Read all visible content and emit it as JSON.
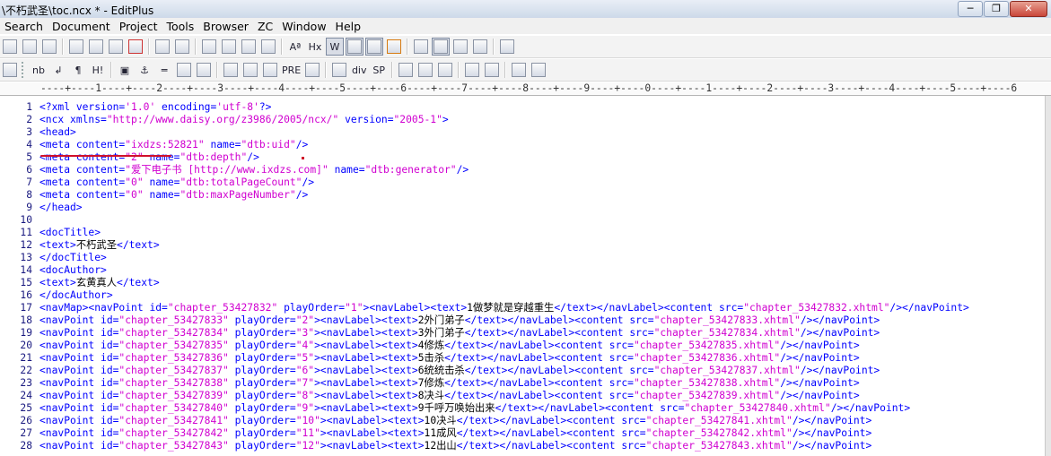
{
  "window": {
    "title": "\\不朽武圣\\toc.ncx * - EditPlus",
    "min": "─",
    "max": "❐",
    "close": "✕"
  },
  "menu": [
    "Search",
    "Document",
    "Project",
    "Tools",
    "Browser",
    "ZC",
    "Window",
    "Help"
  ],
  "toolbar2_labels": {
    "nb": "nb",
    "br": "↲",
    "para": "¶",
    "heading": "H!",
    "image": "▣",
    "anchor": "⚓",
    "hr": "═",
    "pre": "PRE",
    "div": "div",
    "sp": "SP",
    "hx": "Hx",
    "aa": "Aª",
    "bold_w": "W"
  },
  "ruler": "----+----1----+----2----+----3----+----4----+----5----+----6----+----7----+----8----+----9----+----0----+----1----+----2----+----3----+----4----+----5----+----6",
  "lines": [
    {
      "n": "1",
      "parts": [
        [
          "t",
          "<?xml "
        ],
        [
          "a",
          "version="
        ],
        [
          "s",
          "'1.0'"
        ],
        [
          "a",
          " encoding="
        ],
        [
          "s",
          "'utf-8'"
        ],
        [
          "t",
          "?>"
        ]
      ]
    },
    {
      "n": "2",
      "parts": [
        [
          "t",
          "<ncx "
        ],
        [
          "a",
          "xmlns="
        ],
        [
          "s",
          "\"http://www.daisy.org/z3986/2005/ncx/\""
        ],
        [
          "a",
          " version="
        ],
        [
          "s",
          "\"2005-1\""
        ],
        [
          "t",
          ">"
        ]
      ]
    },
    {
      "n": "3",
      "parts": [
        [
          "t",
          "<head>"
        ]
      ]
    },
    {
      "n": "4",
      "parts": [
        [
          "t",
          "<meta "
        ],
        [
          "a",
          "content="
        ],
        [
          "s",
          "\"ixdzs:52821\""
        ],
        [
          "a",
          " name="
        ],
        [
          "s",
          "\"dtb:uid\""
        ],
        [
          "t",
          "/>"
        ]
      ]
    },
    {
      "n": "5",
      "parts": [
        [
          "t",
          "<meta "
        ],
        [
          "a",
          "content="
        ],
        [
          "s",
          "\"2\""
        ],
        [
          "a",
          " name="
        ],
        [
          "s",
          "\"dtb:depth\""
        ],
        [
          "t",
          "/>"
        ]
      ]
    },
    {
      "n": "6",
      "parts": [
        [
          "t",
          "<meta "
        ],
        [
          "a",
          "content="
        ],
        [
          "s",
          "\"爱下电子书 [http://www.ixdzs.com]\""
        ],
        [
          "a",
          " name="
        ],
        [
          "s",
          "\"dtb:generator\""
        ],
        [
          "t",
          "/>"
        ]
      ]
    },
    {
      "n": "7",
      "parts": [
        [
          "t",
          "<meta "
        ],
        [
          "a",
          "content="
        ],
        [
          "s",
          "\"0\""
        ],
        [
          "a",
          " name="
        ],
        [
          "s",
          "\"dtb:totalPageCount\""
        ],
        [
          "t",
          "/>"
        ]
      ]
    },
    {
      "n": "8",
      "parts": [
        [
          "t",
          "<meta "
        ],
        [
          "a",
          "content="
        ],
        [
          "s",
          "\"0\""
        ],
        [
          "a",
          " name="
        ],
        [
          "s",
          "\"dtb:maxPageNumber\""
        ],
        [
          "t",
          "/>"
        ]
      ]
    },
    {
      "n": "9",
      "parts": [
        [
          "t",
          "</head>"
        ]
      ]
    },
    {
      "n": "10",
      "parts": []
    },
    {
      "n": "11",
      "parts": [
        [
          "t",
          "<docTitle>"
        ]
      ]
    },
    {
      "n": "12",
      "parts": [
        [
          "t",
          "<text>"
        ],
        [
          "x",
          "不朽武圣"
        ],
        [
          "t",
          "</text>"
        ]
      ]
    },
    {
      "n": "13",
      "parts": [
        [
          "t",
          "</docTitle>"
        ]
      ]
    },
    {
      "n": "14",
      "parts": [
        [
          "t",
          "<docAuthor>"
        ]
      ]
    },
    {
      "n": "15",
      "parts": [
        [
          "t",
          "<text>"
        ],
        [
          "x",
          "玄黄真人"
        ],
        [
          "t",
          "</text>"
        ]
      ]
    },
    {
      "n": "16",
      "parts": [
        [
          "t",
          "</docAuthor>"
        ]
      ]
    },
    {
      "n": "17",
      "parts": [
        [
          "t",
          "<navMap><navPoint "
        ],
        [
          "a",
          "id="
        ],
        [
          "s",
          "\"chapter_53427832\""
        ],
        [
          "a",
          " playOrder="
        ],
        [
          "s",
          "\"1\""
        ],
        [
          "t",
          "><navLabel><text>"
        ],
        [
          "x",
          "1做梦就是穿越重生"
        ],
        [
          "t",
          "</text></navLabel><content "
        ],
        [
          "a",
          "src="
        ],
        [
          "s",
          "\"chapter_53427832.xhtml\""
        ],
        [
          "t",
          "/></navPoint>"
        ]
      ]
    },
    {
      "n": "18",
      "parts": [
        [
          "t",
          "<navPoint "
        ],
        [
          "a",
          "id="
        ],
        [
          "s",
          "\"chapter_53427833\""
        ],
        [
          "a",
          " playOrder="
        ],
        [
          "s",
          "\"2\""
        ],
        [
          "t",
          "><navLabel><text>"
        ],
        [
          "x",
          "2外门弟子"
        ],
        [
          "t",
          "</text></navLabel><content "
        ],
        [
          "a",
          "src="
        ],
        [
          "s",
          "\"chapter_53427833.xhtml\""
        ],
        [
          "t",
          "/></navPoint>"
        ]
      ]
    },
    {
      "n": "19",
      "parts": [
        [
          "t",
          "<navPoint "
        ],
        [
          "a",
          "id="
        ],
        [
          "s",
          "\"chapter_53427834\""
        ],
        [
          "a",
          " playOrder="
        ],
        [
          "s",
          "\"3\""
        ],
        [
          "t",
          "><navLabel><text>"
        ],
        [
          "x",
          "3外门弟子"
        ],
        [
          "t",
          "</text></navLabel><content "
        ],
        [
          "a",
          "src="
        ],
        [
          "s",
          "\"chapter_53427834.xhtml\""
        ],
        [
          "t",
          "/></navPoint>"
        ]
      ]
    },
    {
      "n": "20",
      "parts": [
        [
          "t",
          "<navPoint "
        ],
        [
          "a",
          "id="
        ],
        [
          "s",
          "\"chapter_53427835\""
        ],
        [
          "a",
          " playOrder="
        ],
        [
          "s",
          "\"4\""
        ],
        [
          "t",
          "><navLabel><text>"
        ],
        [
          "x",
          "4修炼"
        ],
        [
          "t",
          "</text></navLabel><content "
        ],
        [
          "a",
          "src="
        ],
        [
          "s",
          "\"chapter_53427835.xhtml\""
        ],
        [
          "t",
          "/></navPoint>"
        ]
      ]
    },
    {
      "n": "21",
      "parts": [
        [
          "t",
          "<navPoint "
        ],
        [
          "a",
          "id="
        ],
        [
          "s",
          "\"chapter_53427836\""
        ],
        [
          "a",
          " playOrder="
        ],
        [
          "s",
          "\"5\""
        ],
        [
          "t",
          "><navLabel><text>"
        ],
        [
          "x",
          "5击杀"
        ],
        [
          "t",
          "</text></navLabel><content "
        ],
        [
          "a",
          "src="
        ],
        [
          "s",
          "\"chapter_53427836.xhtml\""
        ],
        [
          "t",
          "/></navPoint>"
        ]
      ]
    },
    {
      "n": "22",
      "parts": [
        [
          "t",
          "<navPoint "
        ],
        [
          "a",
          "id="
        ],
        [
          "s",
          "\"chapter_53427837\""
        ],
        [
          "a",
          " playOrder="
        ],
        [
          "s",
          "\"6\""
        ],
        [
          "t",
          "><navLabel><text>"
        ],
        [
          "x",
          "6统统击杀"
        ],
        [
          "t",
          "</text></navLabel><content "
        ],
        [
          "a",
          "src="
        ],
        [
          "s",
          "\"chapter_53427837.xhtml\""
        ],
        [
          "t",
          "/></navPoint>"
        ]
      ]
    },
    {
      "n": "23",
      "parts": [
        [
          "t",
          "<navPoint "
        ],
        [
          "a",
          "id="
        ],
        [
          "s",
          "\"chapter_53427838\""
        ],
        [
          "a",
          " playOrder="
        ],
        [
          "s",
          "\"7\""
        ],
        [
          "t",
          "><navLabel><text>"
        ],
        [
          "x",
          "7修炼"
        ],
        [
          "t",
          "</text></navLabel><content "
        ],
        [
          "a",
          "src="
        ],
        [
          "s",
          "\"chapter_53427838.xhtml\""
        ],
        [
          "t",
          "/></navPoint>"
        ]
      ]
    },
    {
      "n": "24",
      "parts": [
        [
          "t",
          "<navPoint "
        ],
        [
          "a",
          "id="
        ],
        [
          "s",
          "\"chapter_53427839\""
        ],
        [
          "a",
          " playOrder="
        ],
        [
          "s",
          "\"8\""
        ],
        [
          "t",
          "><navLabel><text>"
        ],
        [
          "x",
          "8决斗"
        ],
        [
          "t",
          "</text></navLabel><content "
        ],
        [
          "a",
          "src="
        ],
        [
          "s",
          "\"chapter_53427839.xhtml\""
        ],
        [
          "t",
          "/></navPoint>"
        ]
      ]
    },
    {
      "n": "25",
      "parts": [
        [
          "t",
          "<navPoint "
        ],
        [
          "a",
          "id="
        ],
        [
          "s",
          "\"chapter_53427840\""
        ],
        [
          "a",
          " playOrder="
        ],
        [
          "s",
          "\"9\""
        ],
        [
          "t",
          "><navLabel><text>"
        ],
        [
          "x",
          "9千呼万唤始出来"
        ],
        [
          "t",
          "</text></navLabel><content "
        ],
        [
          "a",
          "src="
        ],
        [
          "s",
          "\"chapter_53427840.xhtml\""
        ],
        [
          "t",
          "/></navPoint>"
        ]
      ]
    },
    {
      "n": "26",
      "parts": [
        [
          "t",
          "<navPoint "
        ],
        [
          "a",
          "id="
        ],
        [
          "s",
          "\"chapter_53427841\""
        ],
        [
          "a",
          " playOrder="
        ],
        [
          "s",
          "\"10\""
        ],
        [
          "t",
          "><navLabel><text>"
        ],
        [
          "x",
          "10决斗"
        ],
        [
          "t",
          "</text></navLabel><content "
        ],
        [
          "a",
          "src="
        ],
        [
          "s",
          "\"chapter_53427841.xhtml\""
        ],
        [
          "t",
          "/></navPoint>"
        ]
      ]
    },
    {
      "n": "27",
      "parts": [
        [
          "t",
          "<navPoint "
        ],
        [
          "a",
          "id="
        ],
        [
          "s",
          "\"chapter_53427842\""
        ],
        [
          "a",
          " playOrder="
        ],
        [
          "s",
          "\"11\""
        ],
        [
          "t",
          "><navLabel><text>"
        ],
        [
          "x",
          "11成风"
        ],
        [
          "t",
          "</text></navLabel><content "
        ],
        [
          "a",
          "src="
        ],
        [
          "s",
          "\"chapter_53427842.xhtml\""
        ],
        [
          "t",
          "/></navPoint>"
        ]
      ]
    },
    {
      "n": "28",
      "parts": [
        [
          "t",
          "<navPoint "
        ],
        [
          "a",
          "id="
        ],
        [
          "s",
          "\"chapter_53427843\""
        ],
        [
          "a",
          " playOrder="
        ],
        [
          "s",
          "\"12\""
        ],
        [
          "t",
          "><navLabel><text>"
        ],
        [
          "x",
          "12出山"
        ],
        [
          "t",
          "</text></navLabel><content "
        ],
        [
          "a",
          "src="
        ],
        [
          "s",
          "\"chapter_53427843.xhtml\""
        ],
        [
          "t",
          "/></navPoint>"
        ]
      ]
    }
  ],
  "colors": {
    "tag": "#0000ff",
    "string": "#d000d0",
    "text": "#000000",
    "line_number": "#1a1a80",
    "annotation": "#d0102a"
  }
}
